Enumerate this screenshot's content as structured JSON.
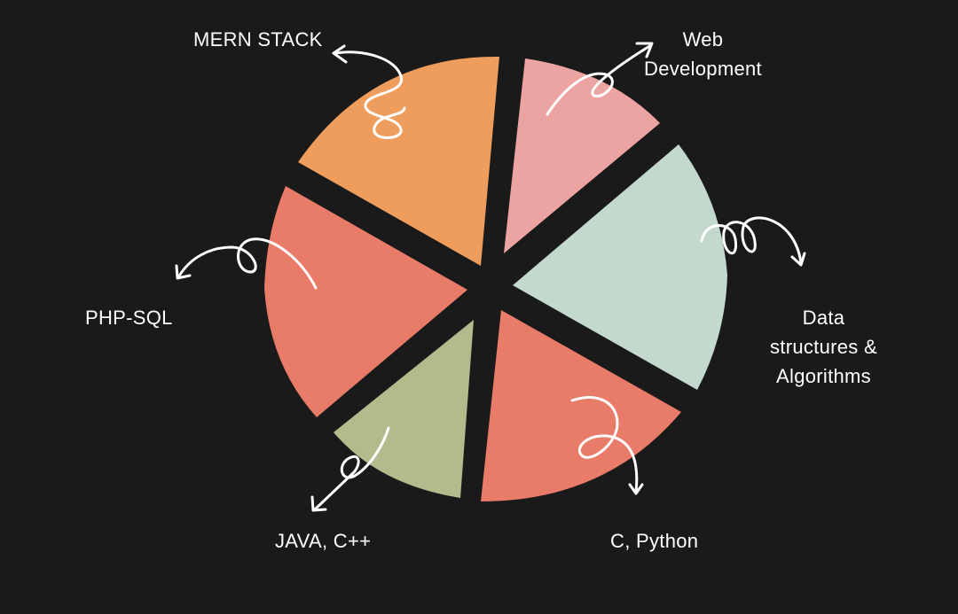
{
  "background_color": "#1b1a1a",
  "label_color": "#ffffff",
  "arrow_color": "#ffffff",
  "segments": [
    {
      "id": "mern-stack",
      "label_lines": [
        "MERN STACK"
      ],
      "color": "#ee9d5d"
    },
    {
      "id": "web-development",
      "label_lines": [
        "Web",
        "Development"
      ],
      "color": "#eca4a3"
    },
    {
      "id": "data-structures",
      "label_lines": [
        "Data",
        "structures &",
        "Algorithms"
      ],
      "color": "#c3d9ce"
    },
    {
      "id": "c-python",
      "label_lines": [
        "C, Python"
      ],
      "color": "#e97b69"
    },
    {
      "id": "java-cpp",
      "label_lines": [
        "JAVA, C++"
      ],
      "color": "#b1bb8c"
    },
    {
      "id": "php-sql",
      "label_lines": [
        "PHP-SQL"
      ],
      "color": "#e97b69"
    }
  ]
}
